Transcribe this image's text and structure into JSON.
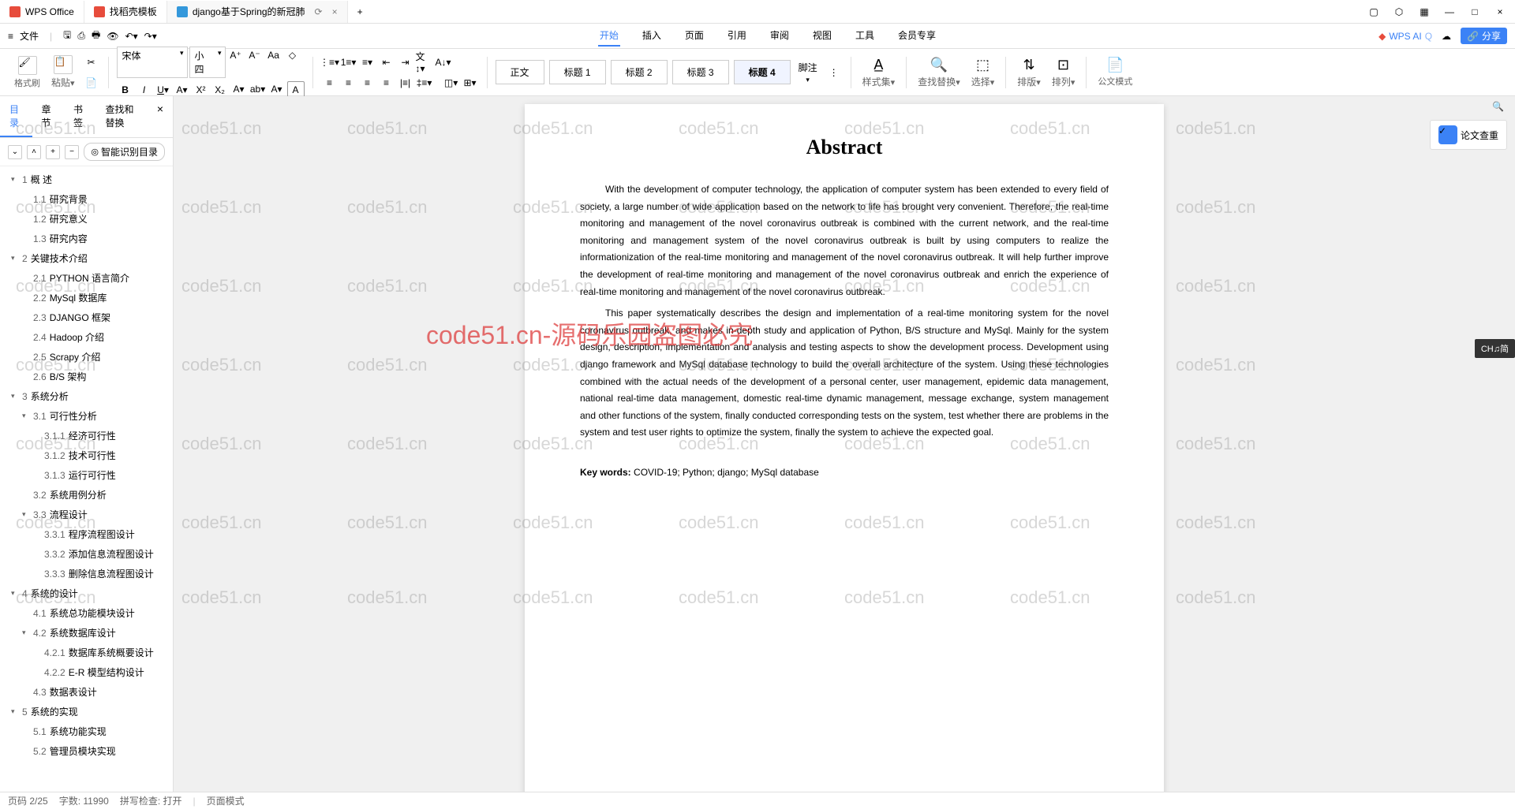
{
  "titlebar": {
    "tabs": [
      {
        "icon": "wps",
        "label": "WPS Office"
      },
      {
        "icon": "template",
        "label": "找稻壳模板"
      },
      {
        "icon": "doc",
        "label": "django基于Spring的新冠肺"
      }
    ]
  },
  "menubar": {
    "file": "文件",
    "items": [
      "开始",
      "插入",
      "页面",
      "引用",
      "审阅",
      "视图",
      "工具",
      "会员专享"
    ],
    "wpsai": "WPS AI",
    "share": "分享"
  },
  "toolbar": {
    "format_brush": "格式刷",
    "paste": "粘贴",
    "font_name": "宋体",
    "font_size": "小四",
    "style_body": "正文",
    "style_h1": "标题 1",
    "style_h2": "标题 2",
    "style_h3": "标题 3",
    "style_h4": "标题 4",
    "annotation": "脚注",
    "style_set": "样式集",
    "find_replace": "查找替换",
    "select": "选择",
    "sort": "排版",
    "align": "排列",
    "gov_mode": "公文模式"
  },
  "sidebar": {
    "tabs": {
      "toc": "目录",
      "chapter": "章节",
      "bookmark": "书签",
      "find": "查找和替换"
    },
    "smart_toc": "智能识别目录",
    "items": [
      {
        "lvl": 1,
        "caret": "▾",
        "num": "1",
        "text": "概    述"
      },
      {
        "lvl": 2,
        "num": "1.1",
        "text": "研究背景"
      },
      {
        "lvl": 2,
        "num": "1.2",
        "text": "研究意义"
      },
      {
        "lvl": 2,
        "num": "1.3",
        "text": "研究内容"
      },
      {
        "lvl": 1,
        "caret": "▾",
        "num": "2",
        "text": "关键技术介绍"
      },
      {
        "lvl": 2,
        "num": "2.1",
        "text": "PYTHON 语言简介"
      },
      {
        "lvl": 2,
        "num": "2.2",
        "text": "MySql 数据库"
      },
      {
        "lvl": 2,
        "num": "2.3",
        "text": "DJANGO 框架"
      },
      {
        "lvl": 2,
        "num": "2.4",
        "text": "Hadoop 介绍"
      },
      {
        "lvl": 2,
        "num": "2.5",
        "text": "Scrapy 介绍"
      },
      {
        "lvl": 2,
        "num": "2.6",
        "text": "B/S 架构"
      },
      {
        "lvl": 1,
        "caret": "▾",
        "num": "3",
        "text": "系统分析"
      },
      {
        "lvl": 2,
        "caret": "▾",
        "num": "3.1",
        "text": "可行性分析"
      },
      {
        "lvl": 3,
        "num": "3.1.1",
        "text": "经济可行性"
      },
      {
        "lvl": 3,
        "num": "3.1.2",
        "text": "技术可行性"
      },
      {
        "lvl": 3,
        "num": "3.1.3",
        "text": "运行可行性"
      },
      {
        "lvl": 2,
        "num": "3.2",
        "text": "系统用例分析"
      },
      {
        "lvl": 2,
        "caret": "▾",
        "num": "3.3",
        "text": "流程设计"
      },
      {
        "lvl": 3,
        "num": "3.3.1",
        "text": "程序流程图设计"
      },
      {
        "lvl": 3,
        "num": "3.3.2",
        "text": "添加信息流程图设计"
      },
      {
        "lvl": 3,
        "num": "3.3.3",
        "text": "删除信息流程图设计"
      },
      {
        "lvl": 1,
        "caret": "▾",
        "num": "4",
        "text": "系统的设计"
      },
      {
        "lvl": 2,
        "num": "4.1",
        "text": "系统总功能模块设计"
      },
      {
        "lvl": 2,
        "caret": "▾",
        "num": "4.2",
        "text": "系统数据库设计"
      },
      {
        "lvl": 3,
        "num": "4.2.1",
        "text": "数据库系统概要设计"
      },
      {
        "lvl": 3,
        "num": "4.2.2",
        "text": "E-R 模型结构设计"
      },
      {
        "lvl": 2,
        "num": "4.3",
        "text": "数据表设计"
      },
      {
        "lvl": 1,
        "caret": "▾",
        "num": "5",
        "text": "系统的实现"
      },
      {
        "lvl": 2,
        "num": "5.1",
        "text": "系统功能实现"
      },
      {
        "lvl": 2,
        "num": "5.2",
        "text": "管理员模块实现"
      }
    ]
  },
  "document": {
    "abstract_title": "Abstract",
    "para1": "With the development of computer technology, the application of computer system has been extended to every field of society, a large number of wide application based on the network to life has brought very convenient. Therefore, the real-time monitoring and management of the novel coronavirus outbreak is combined with the current network, and the real-time monitoring and management system of the novel coronavirus outbreak is built by using computers to realize the informationization of the real-time monitoring and management of the novel coronavirus outbreak. It will help further improve the development of real-time monitoring and management of the novel coronavirus outbreak and enrich the experience of real-time monitoring and management of the novel coronavirus outbreak.",
    "para2": "This paper systematically describes the design and implementation of a real-time monitoring system for the novel coronavirus outbreak, and makes in-depth study and application of Python, B/S structure and MySql. Mainly for the system design, description, implementation and analysis and testing aspects to show the development process. Development using django framework and MySql database technology to build the overall architecture of the system. Using these technologies combined with the actual needs of the development of a personal center, user management, epidemic data management, national real-time data management, domestic real-time dynamic management, message exchange, system management and other functions of the system, finally conducted corresponding tests on the system, test whether there are problems in the system and test user rights to optimize the system, finally the system to achieve the expected goal.",
    "keywords_label": "Key words:",
    "keywords_text": " COVID-19; Python; django; MySql database"
  },
  "rightpanel": {
    "check": "论文查重"
  },
  "watermark": {
    "text": "code51.cn",
    "red": "code51.cn-源码乐园盗图必究"
  },
  "ime": "CH♫简",
  "statusbar": {
    "page": "页码 2/25",
    "words": "字数: 11990",
    "proof": "拼写检查: 打开",
    "mode": "页面模式"
  }
}
